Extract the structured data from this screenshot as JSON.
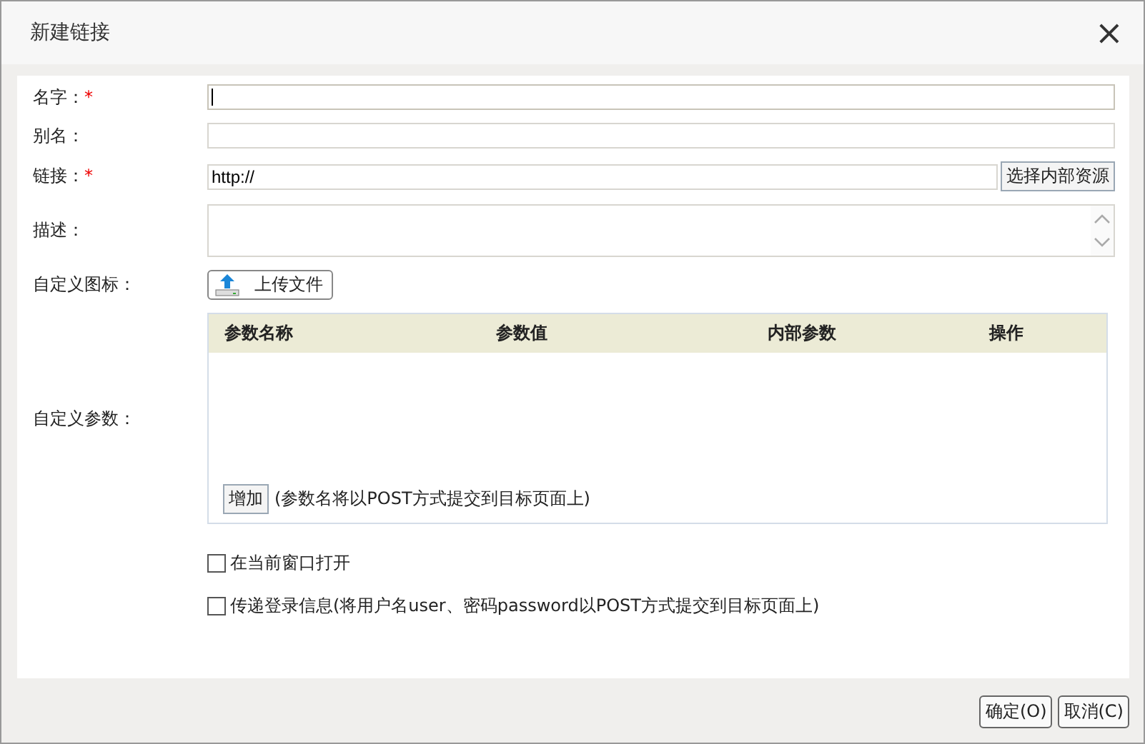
{
  "window": {
    "title": "新建链接",
    "close": "×"
  },
  "required_mark": "*",
  "form": {
    "fields": [
      {
        "kind": "input",
        "label": "名字：",
        "required": true,
        "focused": true
      },
      {
        "kind": "input",
        "label": "别名：",
        "required": false,
        "focused": false
      },
      {
        "kind": "link",
        "label": "链接：",
        "required": true,
        "value": "http://",
        "button": "选择内部资源"
      },
      {
        "kind": "textarea",
        "label": "描述：",
        "required": false
      },
      {
        "kind": "upload",
        "label": "自定义图标：",
        "required": false,
        "button": "上传文件"
      },
      {
        "kind": "params",
        "label": "自定义参数：",
        "required": false,
        "columns": [
          "参数名称",
          "参数值",
          "内部参数",
          "操作"
        ],
        "add_button": "增加",
        "note": "(参数名将以POST方式提交到目标页面上)"
      }
    ],
    "options": [
      {
        "label": "在当前窗口打开",
        "checked": false
      },
      {
        "label": "传递登录信息(将用户名user、密码password以POST方式提交到目标页面上)",
        "checked": false
      }
    ]
  },
  "buttons": [
    "确定(O)",
    "取消(C)"
  ]
}
